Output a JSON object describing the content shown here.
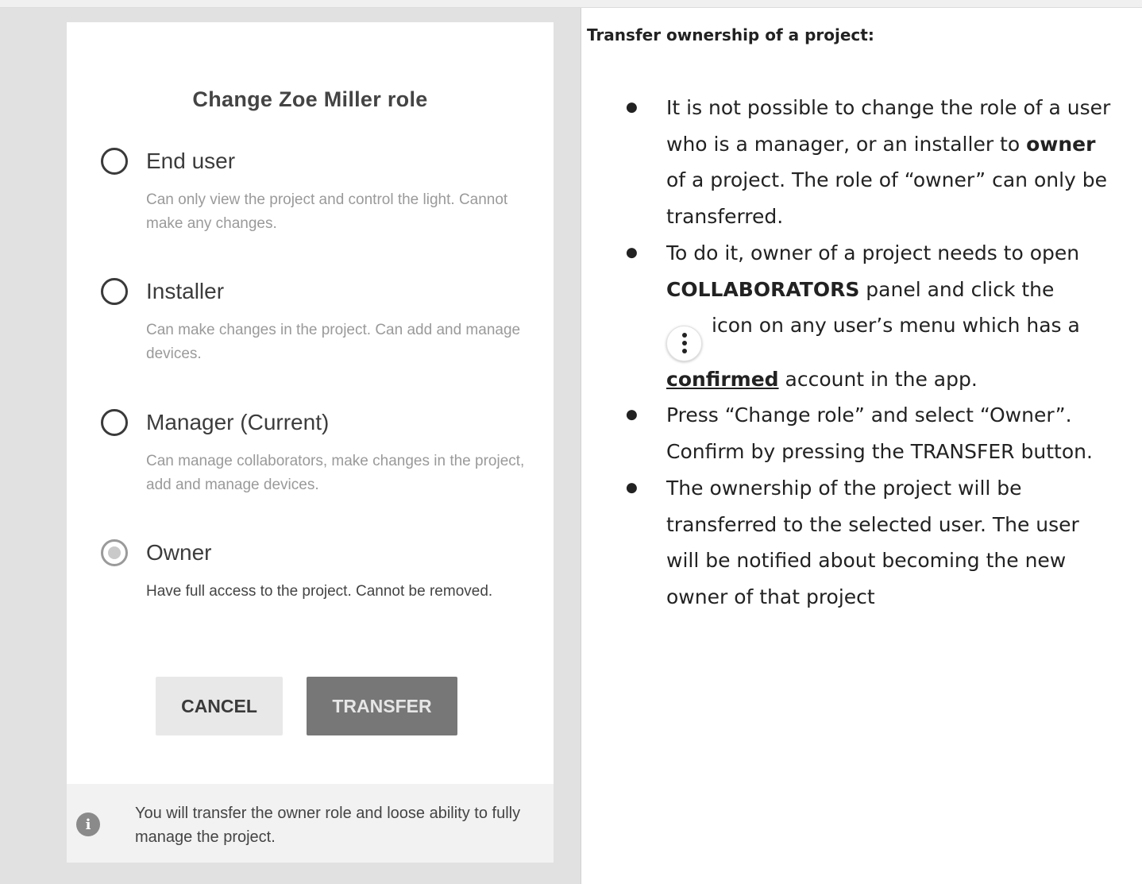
{
  "dialog": {
    "title": "Change Zoe Miller role",
    "options": [
      {
        "label": "End user",
        "description": "Can only view the project and control the light. Cannot make any changes.",
        "selected": false
      },
      {
        "label": "Installer",
        "description": "Can make changes in the project. Can add and manage devices.",
        "selected": false
      },
      {
        "label": "Manager (Current)",
        "description": "Can manage collaborators, make changes in the project, add and manage devices.",
        "selected": false
      },
      {
        "label": "Owner",
        "description": "Have full access to the project. Cannot be removed.",
        "selected": true
      }
    ],
    "cancel_label": "CANCEL",
    "transfer_label": "TRANSFER",
    "notice": "You will transfer the owner role and loose ability to fully manage the project.",
    "notice_icon": "info-icon"
  },
  "doc": {
    "heading": "Transfer ownership of a project:",
    "bullet_glyph": "●",
    "b1": {
      "t1": "It is not possible to change the role of a user who is a manager, or an installer to ",
      "bold": "owner",
      "t2": " of a project. The role of “owner” can only  be transferred."
    },
    "b2": {
      "t1": "To do it, owner of a project needs to open ",
      "bold": "COLLABORATORS",
      "t2": " panel and click the",
      "icon": "more-vertical-icon",
      "t3": "icon on any user’s menu which has a ",
      "underline": "confirmed",
      "t4": " account in the app."
    },
    "b3": "Press “Change role” and select “Owner”. Confirm by pressing the TRANSFER button.",
    "b4": "The ownership of the project will be transferred to the selected user. The user will be notified about becoming the new owner of that project"
  },
  "colors": {
    "panel_bg": "#e1e1e1",
    "transfer_btn": "#777777",
    "cancel_btn": "#e8e8e8"
  }
}
